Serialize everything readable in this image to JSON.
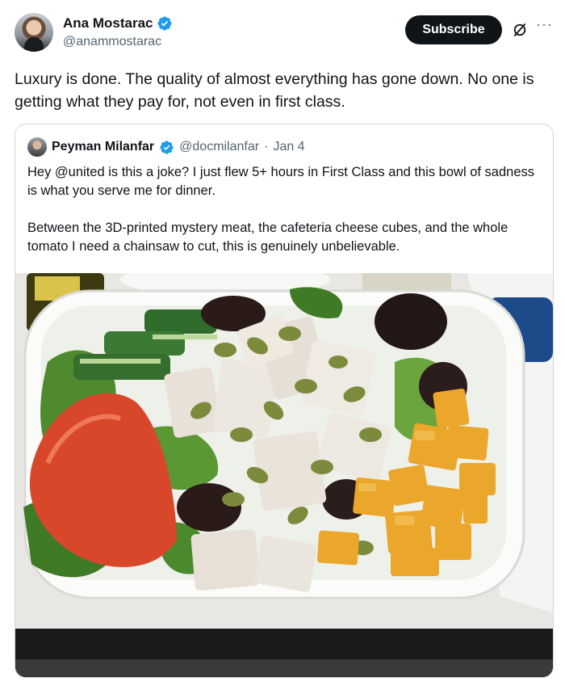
{
  "author": {
    "display_name": "Ana Mostarac",
    "handle": "@anammostarac",
    "verified": true
  },
  "actions": {
    "subscribe_label": "Subscribe",
    "grok_icon": "grok-icon",
    "more_icon": "more-icon",
    "more_glyph": "···"
  },
  "tweet": {
    "text": "Luxury is done. The quality of almost everything has gone down. No one is getting what they pay for, not even in first class."
  },
  "quote": {
    "display_name": "Peyman Milanfar",
    "handle": "@docmilanfar",
    "separator": "·",
    "date": "Jan 4",
    "verified": true,
    "text": "Hey @united is this a joke? I just flew 5+ hours in First Class and this bowl of sadness is what you serve me for dinner.\n\nBetween the 3D-printed mystery meat, the cafeteria cheese cubes, and the whole tomato I need a chainsaw to cut, this is genuinely unbelievable."
  },
  "colors": {
    "accent_verified": "#1d9bf0",
    "text_primary": "#0f1419",
    "text_secondary": "#536471",
    "border": "#cfd9de"
  }
}
